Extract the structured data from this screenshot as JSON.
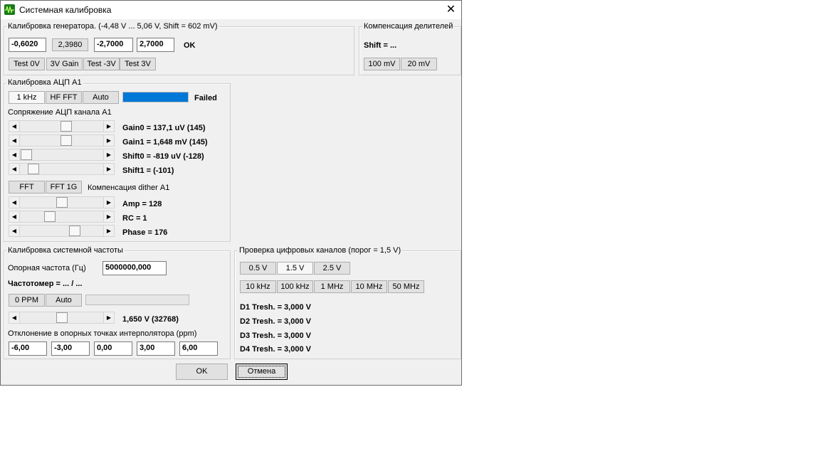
{
  "window": {
    "title": "Системная калибровка",
    "close_glyph": "✕"
  },
  "generator": {
    "group_label": "Калибровка генератора.   (-4,48 V ... 5,06 V, Shift = 602 mV)",
    "field1": "-0,6020",
    "button_value": "2,3980",
    "field2": "-2,7000",
    "field3": "2,7000",
    "status": "OK",
    "buttons": [
      "Test 0V",
      "3V Gain",
      "Test -3V",
      "Test 3V"
    ]
  },
  "divider": {
    "group_label": "Компенсация делителей",
    "shift_text": "Shift = ...",
    "buttons": [
      "100 mV",
      "20 mV"
    ]
  },
  "adc": {
    "group_label": "Калибровка АЦП А1",
    "buttons": [
      "1 kHz",
      "HF FFT",
      "Auto"
    ],
    "progress": 1.0,
    "status": "Failed",
    "coupling_label": "Сопряжение АЦП канала А1",
    "gain0": "Gain0  = 137,1 uV (145)",
    "gain1": "Gain1  = 1,648 mV (145)",
    "shift0": "Shift0 = -819 uV (-128)",
    "shift1": "Shift1 = (-101)",
    "fft_buttons": [
      "FFT",
      "FFT 1G"
    ],
    "dither_label": "Компенсация dither А1",
    "amp": "Amp = 128",
    "rc": "RC = 1",
    "phase": "Phase = 176"
  },
  "sysfreq": {
    "group_label": "Калибровка системной частоты",
    "ref_freq_label": "Опорная частота (Гц)",
    "ref_freq_value": "5000000,000",
    "counter_label": "Частотомер = ... / ...",
    "buttons": [
      "0 PPM",
      "Auto"
    ],
    "slider_value": "1,650 V (32768)",
    "deviation_label": "Отклонение в опорных точках интерполятора (ppm)",
    "deviation_values": [
      "-6,00",
      "-3,00",
      "0,00",
      "3,00",
      "6,00"
    ]
  },
  "digital": {
    "group_label": "Проверка цифровых каналов (порог = 1,5 V)",
    "threshold_buttons": [
      "0.5 V",
      "1.5 V",
      "2.5 V"
    ],
    "freq_buttons": [
      "10 kHz",
      "100 kHz",
      "1 MHz",
      "10 MHz",
      "50 MHz"
    ],
    "d1": "D1 Tresh. = 3,000 V",
    "d2": "D2 Tresh. = 3,000 V",
    "d3": "D3 Tresh. = 3,000 V",
    "d4": "D4 Tresh. = 3,000 V"
  },
  "footer": {
    "ok": "OK",
    "cancel": "Отмена"
  },
  "colors": {
    "accent": "#0078d7",
    "window_bg": "#f0f0f0",
    "icon_green": "#1a7a1a"
  },
  "icons": {
    "app": "oscilloscope-icon",
    "close": "close-icon",
    "arrow_left": "◀",
    "arrow_right": "▶"
  }
}
